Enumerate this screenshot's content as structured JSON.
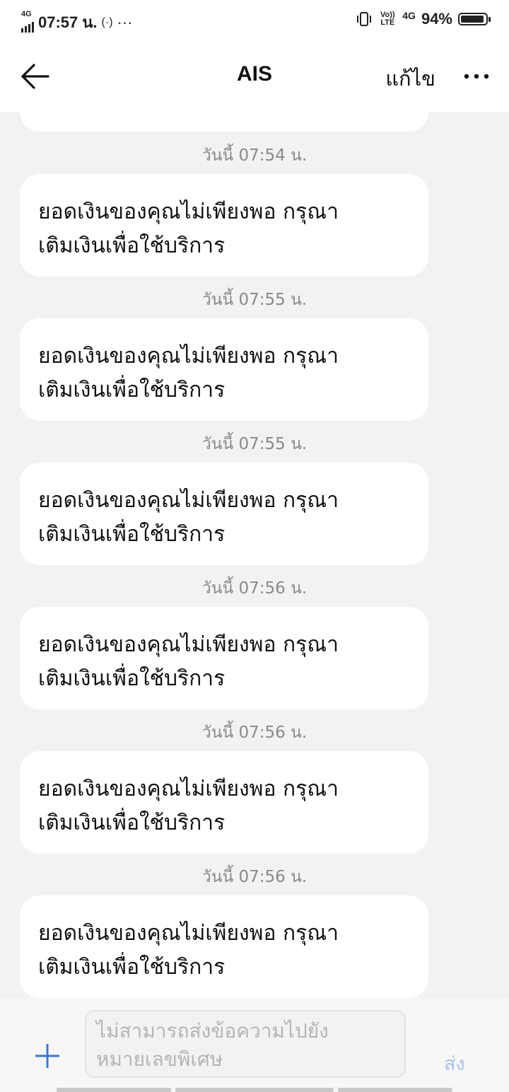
{
  "status_bar": {
    "network_type": "4G",
    "time": "07:57 น.",
    "extra": "···",
    "volte_label": "Vo)) LTE",
    "network_right": "4G",
    "battery": "94%",
    "battery_level": 0.94
  },
  "header": {
    "title": "AIS",
    "edit_label": "แก้ไข"
  },
  "messages": [
    {
      "timestamp": "วันนี้ 07:54 น.",
      "line1": "ยอดเงินของคุณไม่เพียงพอ กรุณา",
      "line2": "เติมเงินเพื่อใช้บริการ"
    },
    {
      "timestamp": "วันนี้ 07:55 น.",
      "line1": "ยอดเงินของคุณไม่เพียงพอ กรุณา",
      "line2": "เติมเงินเพื่อใช้บริการ"
    },
    {
      "timestamp": "วันนี้ 07:55 น.",
      "line1": "ยอดเงินของคุณไม่เพียงพอ กรุณา",
      "line2": "เติมเงินเพื่อใช้บริการ"
    },
    {
      "timestamp": "วันนี้ 07:56 น.",
      "line1": "ยอดเงินของคุณไม่เพียงพอ กรุณา",
      "line2": "เติมเงินเพื่อใช้บริการ"
    },
    {
      "timestamp": "วันนี้ 07:56 น.",
      "line1": "ยอดเงินของคุณไม่เพียงพอ กรุณา",
      "line2": "เติมเงินเพื่อใช้บริการ"
    },
    {
      "timestamp": "วันนี้ 07:56 น.",
      "line1": "ยอดเงินของคุณไม่เพียงพอ กรุณา",
      "line2": "เติมเงินเพื่อใช้บริการ"
    }
  ],
  "composer": {
    "placeholder_line1": "ไม่สามารถส่งข้อความไปยัง",
    "placeholder_line2": "หมายเลขพิเศษ",
    "send_label": "ส่ง"
  },
  "colors": {
    "background": "#f2f2f2",
    "bubble": "#ffffff",
    "send_disabled": "#a9c4ec",
    "add_icon": "#3a78d8"
  }
}
